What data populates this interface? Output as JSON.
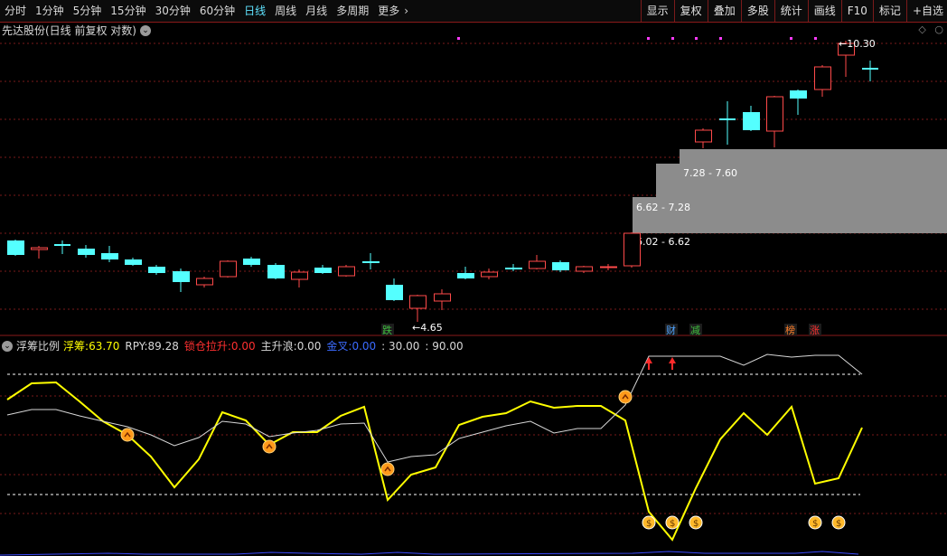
{
  "toolbar": {
    "tabs": [
      {
        "label": "分时"
      },
      {
        "label": "1分钟"
      },
      {
        "label": "5分钟"
      },
      {
        "label": "15分钟"
      },
      {
        "label": "30分钟"
      },
      {
        "label": "60分钟"
      },
      {
        "label": "日线"
      },
      {
        "label": "周线"
      },
      {
        "label": "月线"
      },
      {
        "label": "多周期"
      },
      {
        "label": "更多"
      }
    ],
    "active": "日线",
    "right": [
      {
        "label": "显示"
      },
      {
        "label": "复权"
      },
      {
        "label": "叠加"
      },
      {
        "label": "多股"
      },
      {
        "label": "统计"
      },
      {
        "label": "画线"
      },
      {
        "label": "F10"
      },
      {
        "label": "标记"
      },
      {
        "label": "+自选"
      }
    ]
  },
  "main_chart": {
    "title": "先达股份(日线 前复权 对数)",
    "high_label": "10.30",
    "low_label": "4.65",
    "zones": [
      {
        "label": "7.28 - 7.60"
      },
      {
        "label": "6.62 - 7.28"
      },
      {
        "label": "6.02 - 6.62"
      }
    ],
    "markers": [
      {
        "text": "跌",
        "color": "#3fbf3f"
      },
      {
        "text": "财",
        "color": "#4fa3ff"
      },
      {
        "text": "减",
        "color": "#3fbf3f"
      },
      {
        "text": "榜",
        "color": "#ff7f2a"
      },
      {
        "text": "涨",
        "color": "#ff3030"
      }
    ]
  },
  "indicator": {
    "name": "浮筹比例",
    "floating_label": "浮筹:",
    "floating_value": "63.70",
    "rpy_label": "RPY:",
    "rpy_value": "89.28",
    "lock_label": "锁仓拉升:",
    "lock_value": "0.00",
    "wave_label": "主升浪:",
    "wave_value": "0.00",
    "gold_label": "金叉:",
    "gold_value": "0.00",
    "level1": ": 30.00",
    "level2": ": 90.00"
  },
  "colors": {
    "up": "#ff4a4a",
    "down": "#54ffff",
    "grid": "#7a1a1a",
    "yellow_line": "#ffff00",
    "white_line": "#d8d8d8"
  }
}
